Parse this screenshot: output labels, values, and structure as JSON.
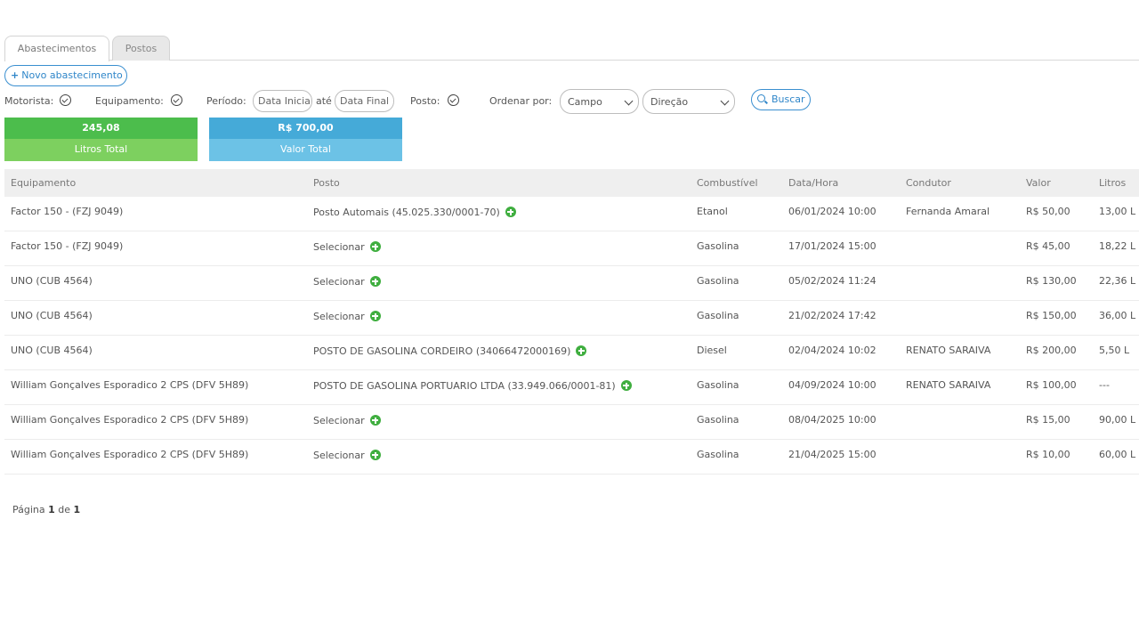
{
  "tabs": [
    {
      "label": "Abastecimentos",
      "active": true
    },
    {
      "label": "Postos",
      "active": false
    }
  ],
  "new_button": {
    "label": "Novo abastecimento"
  },
  "filters": {
    "motorista_label": "Motorista:",
    "equipamento_label": "Equipamento:",
    "periodo_label": "Período:",
    "data_inicial_placeholder": "Data Inicial",
    "ate_label": "até",
    "data_final_placeholder": "Data Final",
    "posto_label": "Posto:",
    "ordenar_label": "Ordenar por:",
    "campo_value": "Campo",
    "direcao_value": "Direção",
    "search_label": "Buscar"
  },
  "summary": {
    "litros_value": "245,08",
    "litros_label": "Litros Total",
    "valor_value": "R$ 700,00",
    "valor_label": "Valor Total"
  },
  "table": {
    "headers": {
      "equipamento": "Equipamento",
      "posto": "Posto",
      "combustivel": "Combustível",
      "data_hora": "Data/Hora",
      "condutor": "Condutor",
      "valor": "Valor",
      "litros": "Litros"
    },
    "rows": [
      {
        "equipamento": "Factor 150 - (FZJ 9049)",
        "posto": "Posto Automais (45.025.330/0001-70)",
        "combustivel": "Etanol",
        "data_hora": "06/01/2024 10:00",
        "condutor": "Fernanda Amaral",
        "valor": "R$ 50,00",
        "litros": "13,00 L"
      },
      {
        "equipamento": "Factor 150 - (FZJ 9049)",
        "posto": "Selecionar",
        "combustivel": "Gasolina",
        "data_hora": "17/01/2024 15:00",
        "condutor": "",
        "valor": "R$ 45,00",
        "litros": "18,22 L"
      },
      {
        "equipamento": "UNO (CUB 4564)",
        "posto": "Selecionar",
        "combustivel": "Gasolina",
        "data_hora": "05/02/2024 11:24",
        "condutor": "",
        "valor": "R$ 130,00",
        "litros": "22,36 L"
      },
      {
        "equipamento": "UNO (CUB 4564)",
        "posto": "Selecionar",
        "combustivel": "Gasolina",
        "data_hora": "21/02/2024 17:42",
        "condutor": "",
        "valor": "R$ 150,00",
        "litros": "36,00 L"
      },
      {
        "equipamento": "UNO (CUB 4564)",
        "posto": "POSTO DE GASOLINA CORDEIRO (34066472000169)",
        "combustivel": "Diesel",
        "data_hora": "02/04/2024 10:02",
        "condutor": "RENATO SARAIVA",
        "valor": "R$ 200,00",
        "litros": "5,50 L"
      },
      {
        "equipamento": "William Gonçalves Esporadico 2 CPS (DFV 5H89)",
        "posto": "POSTO DE GASOLINA PORTUARIO LTDA (33.949.066/0001-81)",
        "combustivel": "Gasolina",
        "data_hora": "04/09/2024 10:00",
        "condutor": "RENATO SARAIVA",
        "valor": "R$ 100,00",
        "litros": "---"
      },
      {
        "equipamento": "William Gonçalves Esporadico 2 CPS (DFV 5H89)",
        "posto": "Selecionar",
        "combustivel": "Gasolina",
        "data_hora": "08/04/2025 10:00",
        "condutor": "",
        "valor": "R$ 15,00",
        "litros": "90,00 L"
      },
      {
        "equipamento": "William Gonçalves Esporadico 2 CPS (DFV 5H89)",
        "posto": "Selecionar",
        "combustivel": "Gasolina",
        "data_hora": "21/04/2025 15:00",
        "condutor": "",
        "valor": "R$ 10,00",
        "litros": "60,00 L"
      }
    ]
  },
  "pagination": {
    "prefix": "Página",
    "current": "1",
    "of": "de",
    "total": "1"
  },
  "colors": {
    "accent_blue": "#2f86c9",
    "green": "#4cbd4c",
    "blue": "#45aad8",
    "add_icon": "#3fae3f"
  }
}
